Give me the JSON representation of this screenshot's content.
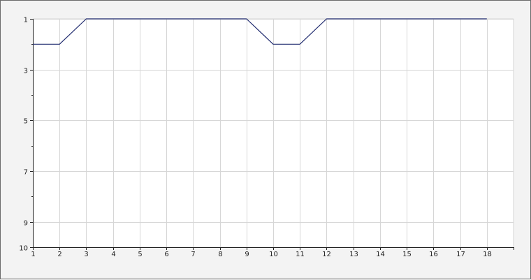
{
  "chart_data": {
    "type": "line",
    "title": "",
    "xlabel": "",
    "ylabel": "",
    "x": [
      1,
      2,
      3,
      4,
      5,
      6,
      7,
      8,
      9,
      10,
      11,
      12,
      13,
      14,
      15,
      16,
      17,
      18
    ],
    "series": [
      {
        "values": [
          2,
          2,
          1,
          1,
          1,
          1,
          1,
          1,
          1,
          2,
          2,
          1,
          1,
          1,
          1,
          1,
          1,
          1
        ]
      }
    ],
    "x_ticks": [
      1,
      2,
      3,
      4,
      5,
      6,
      7,
      8,
      9,
      10,
      11,
      12,
      13,
      14,
      15,
      16,
      17,
      18
    ],
    "y_ticks": [
      1,
      3,
      5,
      7,
      9,
      10
    ],
    "xlim": [
      1,
      19
    ],
    "ylim": [
      1,
      10
    ],
    "y_inverted": true,
    "grid": true,
    "colors": {
      "line": "#1f2a6e",
      "grid": "#d6d6d6",
      "axis": "#222222",
      "plot_background": "#ffffff"
    }
  }
}
